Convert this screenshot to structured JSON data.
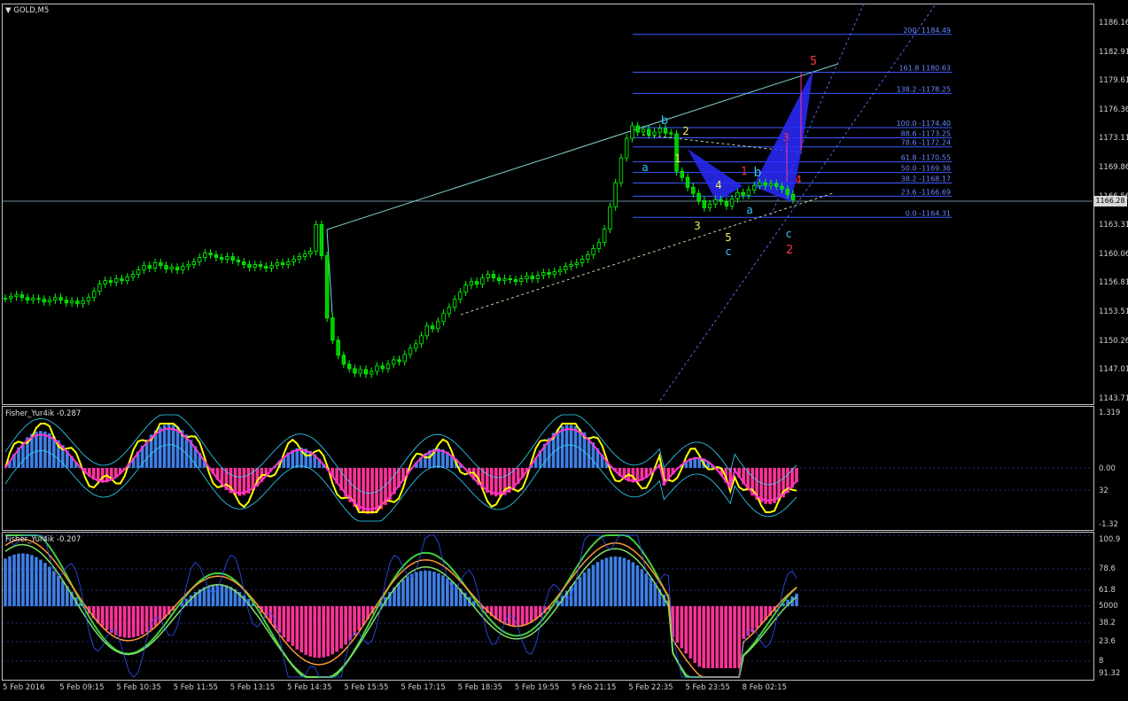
{
  "window": {
    "symbol_title": "GOLD,M5"
  },
  "panes": {
    "main_scale": [
      "1186.16",
      "1182.91",
      "1179.61",
      "1176.36",
      "1173.11",
      "1169.86",
      "1166.56",
      "1163.31",
      "1160.06",
      "1156.81",
      "1153.51",
      "1150.26",
      "1147.01",
      "1143.71"
    ],
    "current_price": "1166.28",
    "ind1_title": "Fisher_Yur4ik -0.287",
    "ind1_scale": [
      "1.319",
      "0.00",
      "32",
      "-1.32"
    ],
    "ind2_title": "Fisher_Yur4ik -0.207",
    "ind2_scale": [
      "100.9",
      "78.6",
      "61.8",
      "5000",
      "38.2",
      "23.6",
      "8",
      "91.32"
    ]
  },
  "fib_levels": [
    "200- 1184.49",
    "161.8 1180.63",
    "138.2 -1178.25",
    "100.0 -1174.40",
    "88.6 -1173.25",
    "78.6 -1172.24",
    "61.8 -1170.55",
    "50.0 -1169.36",
    "38.2 -1168.17",
    "23.6 -1166.69",
    "0.0 -1164.31"
  ],
  "wave_labels": [
    "b",
    "2",
    "1",
    "a",
    "4",
    "1",
    "b",
    "3",
    "a",
    "4",
    "3",
    "5",
    "c",
    "c",
    "2",
    "5"
  ],
  "time_axis": [
    "5 Feb 2016",
    "5 Feb 09:15",
    "5 Feb 10:35",
    "5 Feb 11:55",
    "5 Feb 13:15",
    "5 Feb 14:35",
    "5 Feb 15:55",
    "5 Feb 17:15",
    "5 Feb 18:35",
    "5 Feb 19:55",
    "5 Feb 21:15",
    "5 Feb 22:35",
    "5 Feb 23:55",
    "8 Feb 02:15"
  ],
  "colors": {
    "bull": "#00ff00",
    "bear": "#00c800",
    "fib": "#3c5aff",
    "hist_up": "#3f7fe6",
    "hist_dn": "#ff3399",
    "fisher": "#ffff00",
    "signal": "#ff33cc"
  },
  "chart_data": {
    "type": "candlestick",
    "series": [
      {
        "name": "GOLD,M5",
        "values": [
          1155.2,
          1155.4,
          1155.6,
          1155.3,
          1155.0,
          1155.2,
          1155.1,
          1154.8,
          1155.0,
          1155.3,
          1155.0,
          1154.7,
          1154.9,
          1154.6,
          1154.9,
          1155.3,
          1156.0,
          1156.8,
          1157.2,
          1157.0,
          1157.4,
          1157.2,
          1157.6,
          1157.9,
          1158.4,
          1158.9,
          1158.6,
          1159.2,
          1158.9,
          1158.5,
          1158.7,
          1158.4,
          1158.8,
          1159.0,
          1159.3,
          1159.8,
          1160.3,
          1160.1,
          1159.8,
          1159.6,
          1159.9,
          1159.5,
          1159.3,
          1159.0,
          1158.7,
          1159.0,
          1158.8,
          1158.6,
          1158.9,
          1159.2,
          1159.0,
          1159.3,
          1159.6,
          1159.9,
          1160.2,
          1160.5,
          1163.5,
          1160.0,
          1153.0,
          1150.5,
          1148.8,
          1147.8,
          1147.3,
          1146.8,
          1147.2,
          1146.7,
          1147.0,
          1147.6,
          1147.3,
          1147.8,
          1148.3,
          1148.1,
          1148.9,
          1149.6,
          1150.1,
          1151.0,
          1152.1,
          1151.8,
          1152.6,
          1153.5,
          1154.2,
          1155.1,
          1155.9,
          1156.7,
          1157.1,
          1156.8,
          1157.5,
          1157.9,
          1157.5,
          1157.2,
          1157.4,
          1157.3,
          1157.1,
          1157.4,
          1157.7,
          1157.4,
          1157.8,
          1158.1,
          1157.9,
          1158.2,
          1158.4,
          1158.8,
          1159.0,
          1159.2,
          1159.6,
          1160.1,
          1160.8,
          1161.5,
          1163.0,
          1165.5,
          1168.2,
          1171.0,
          1173.2,
          1174.6,
          1173.9,
          1174.2,
          1173.6,
          1173.9,
          1174.3,
          1173.8,
          1173.7,
          1169.5,
          1168.8,
          1167.7,
          1167.0,
          1166.2,
          1165.4,
          1165.8,
          1166.3,
          1166.1,
          1165.6,
          1166.4,
          1167.1,
          1166.8,
          1167.4,
          1167.9,
          1168.2,
          1167.9,
          1168.1,
          1167.8,
          1167.5,
          1166.9,
          1166.3
        ]
      }
    ],
    "ylim": [
      1143.71,
      1186.16
    ]
  }
}
